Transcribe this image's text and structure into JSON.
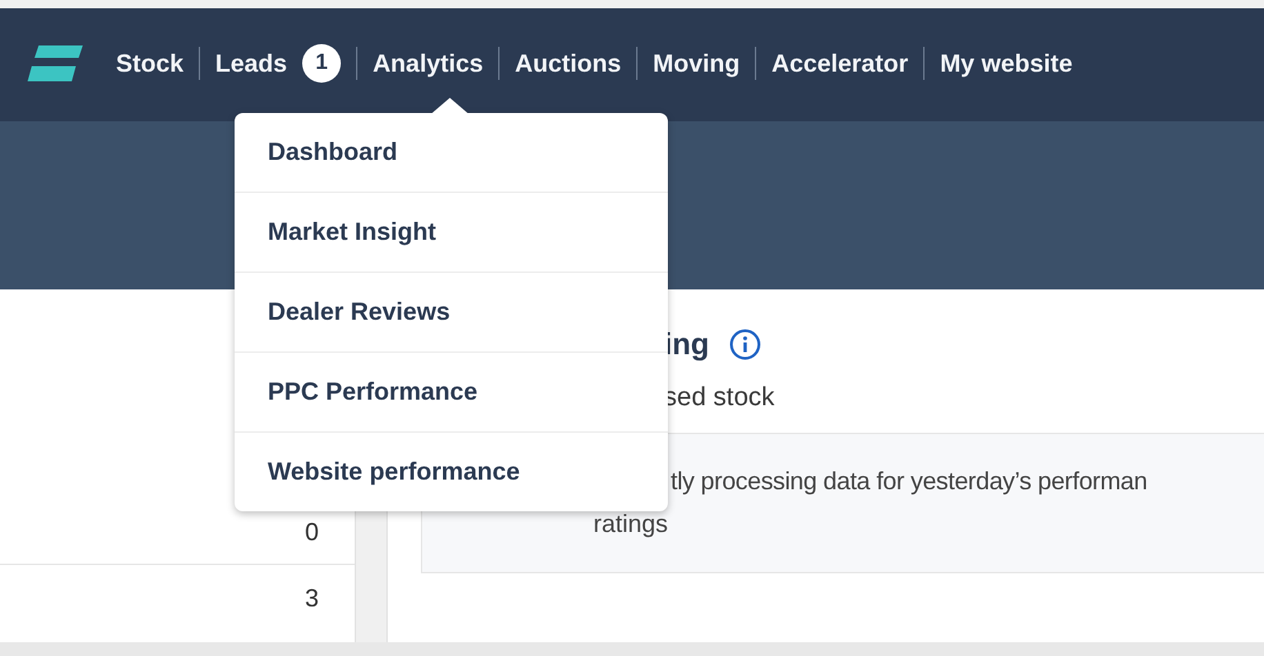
{
  "nav": {
    "items": [
      {
        "label": "Stock"
      },
      {
        "label": "Leads",
        "badge": "1"
      },
      {
        "label": "Analytics"
      },
      {
        "label": "Auctions"
      },
      {
        "label": "Moving"
      },
      {
        "label": "Accelerator"
      },
      {
        "label": "My website"
      }
    ]
  },
  "dropdown": {
    "items": [
      "Dashboard",
      "Market Insight",
      "Dealer Reviews",
      "PPC Performance",
      "Website performance"
    ]
  },
  "left_card": {
    "values": [
      "0",
      "3"
    ]
  },
  "right_card": {
    "heading": "ing",
    "subtitle": "sed stock",
    "notice": "tly processing data for yesterday’s performan",
    "notice_line_2": "ratings"
  }
}
